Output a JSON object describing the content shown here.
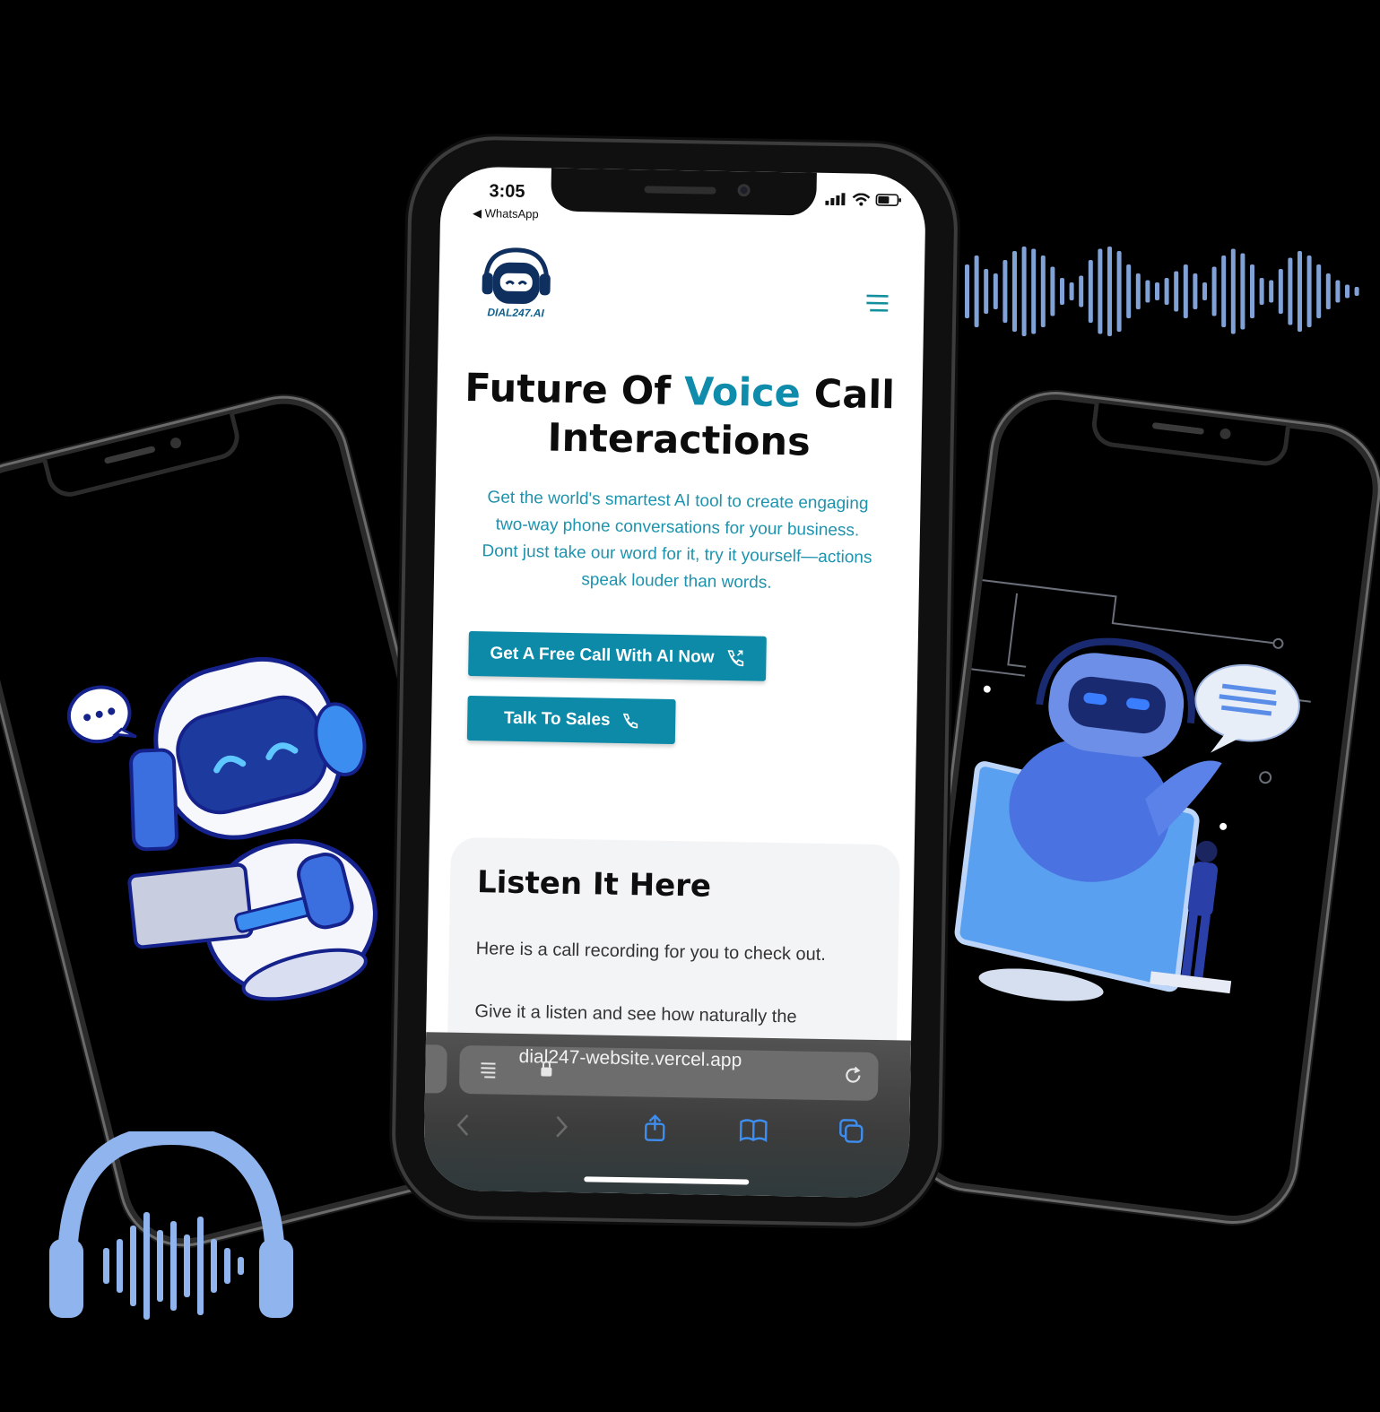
{
  "status_bar": {
    "time": "3:05",
    "back_app": "◀ WhatsApp"
  },
  "site": {
    "logo_text": "DIAL247.AI",
    "hero_title_part1": "Future Of ",
    "hero_title_accent": "Voice",
    "hero_title_part2": " Call Interactions",
    "hero_subtitle_line1": "Get the world's smartest AI tool to create engaging two-way phone conversations for your business.",
    "hero_subtitle_line2": "Dont just take our word for it, try it yourself—actions speak louder than words.",
    "primary_button": "Get A Free Call With AI Now",
    "secondary_button": "Talk To Sales",
    "listen_title": "Listen It Here",
    "listen_text1": "Here is a call recording for you to check out.",
    "listen_text2": "Give it a listen and see how naturally the"
  },
  "browser": {
    "url": "dial247-website.vercel.app",
    "toolbar_icons": [
      "back-icon",
      "forward-icon",
      "share-icon",
      "bookmarks-icon",
      "tabs-icon"
    ]
  },
  "colors": {
    "accent": "#0f8cab",
    "button": "#0c8aa8",
    "illustration_blue": "#3b6fe0",
    "waveform": "#8fb4ee"
  }
}
